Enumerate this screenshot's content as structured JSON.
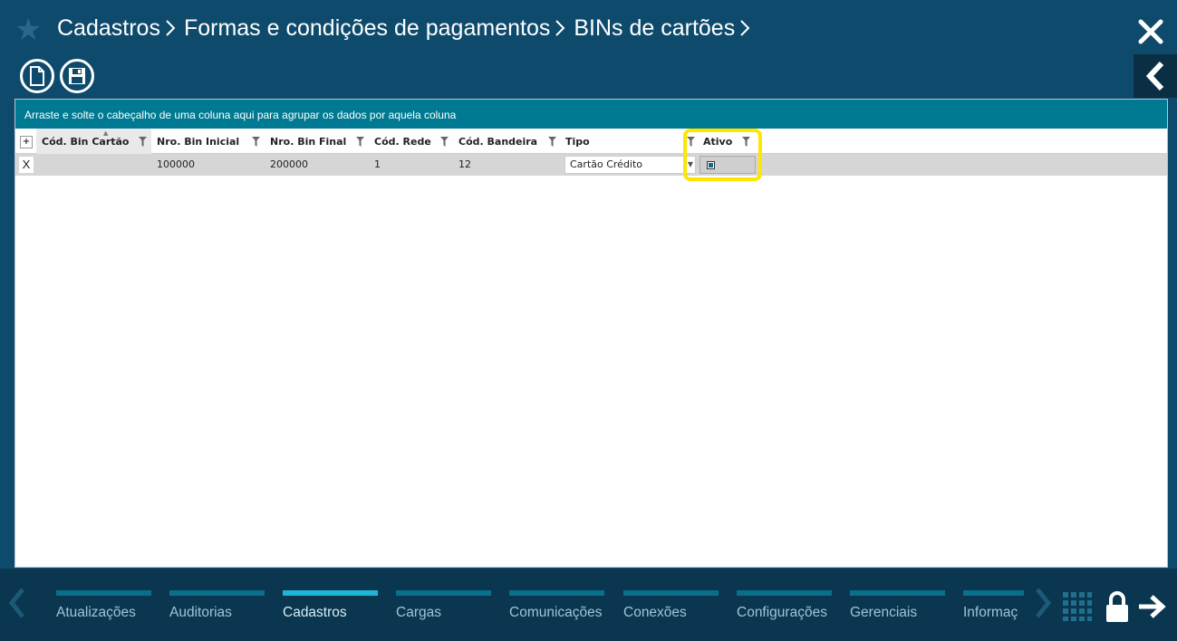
{
  "header": {
    "breadcrumb": [
      "Cadastros",
      "Formas e condições de pagamentos",
      "BINs de cartões"
    ]
  },
  "toolbar": {
    "new_icon": "new-document-icon",
    "save_icon": "save-icon"
  },
  "grid": {
    "group_hint": "Arraste e solte o cabeçalho de uma coluna aqui para agrupar os dados por aquela coluna",
    "expand_label": "+",
    "columns": [
      "Cód. Bin Cartão",
      "Nro. Bin Inicial",
      "Nro. Bin Final",
      "Cód. Rede",
      "Cód. Bandeira",
      "Tipo",
      "Ativo"
    ],
    "rows": [
      {
        "delete_label": "X",
        "cod_bin": "",
        "bin_inicial": "100000",
        "bin_final": "200000",
        "cod_rede": "1",
        "cod_bandeira": "12",
        "tipo": "Cartão Crédito",
        "ativo": true
      }
    ]
  },
  "bottom_nav": {
    "tabs": [
      "Atualizações",
      "Auditorias",
      "Cadastros",
      "Cargas",
      "Comunicações",
      "Conexões",
      "Configurações",
      "Gerenciais",
      "Informaç"
    ],
    "active_tab": "Cadastros"
  },
  "colors": {
    "background": "#0e4a6c",
    "group_bar": "#007a92",
    "highlight": "#ffe600",
    "active_tab": "#1fb5d4"
  }
}
